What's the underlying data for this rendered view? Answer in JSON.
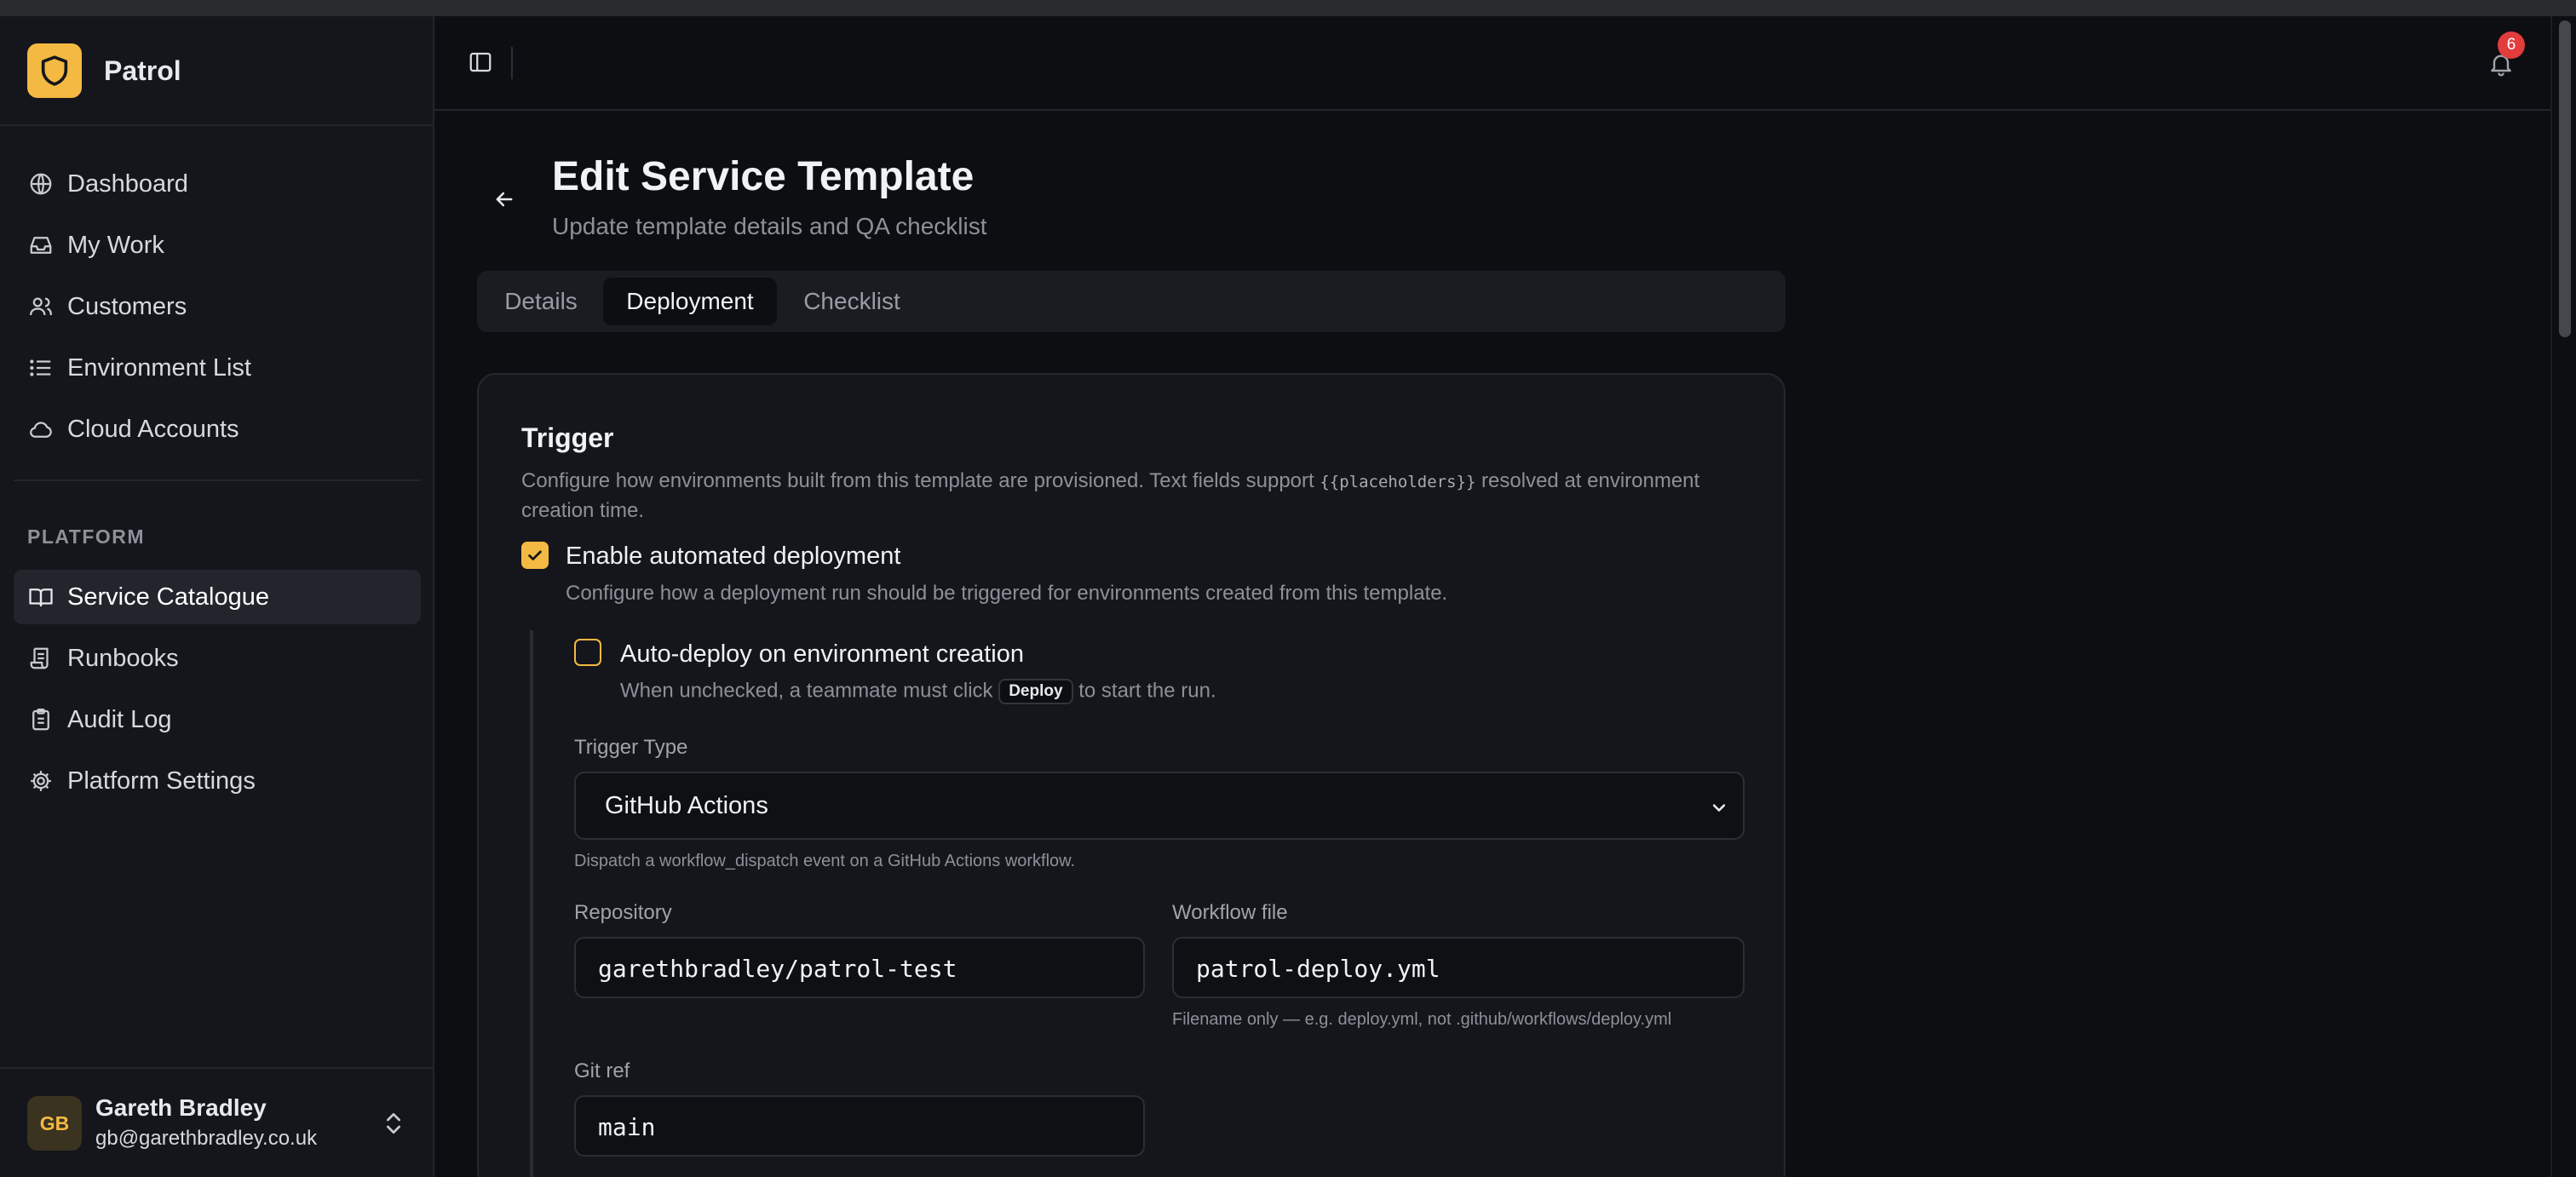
{
  "app": {
    "name": "Patrol"
  },
  "sidebar": {
    "main_items": [
      {
        "label": "Dashboard",
        "icon": "globe-icon"
      },
      {
        "label": "My Work",
        "icon": "inbox-icon"
      },
      {
        "label": "Customers",
        "icon": "users-icon"
      },
      {
        "label": "Environment List",
        "icon": "list-icon"
      },
      {
        "label": "Cloud Accounts",
        "icon": "cloud-icon"
      }
    ],
    "section_label": "PLATFORM",
    "platform_items": [
      {
        "label": "Service Catalogue",
        "icon": "book-icon",
        "active": true
      },
      {
        "label": "Runbooks",
        "icon": "scroll-icon"
      },
      {
        "label": "Audit Log",
        "icon": "clipboard-icon"
      },
      {
        "label": "Platform Settings",
        "icon": "gear-icon"
      }
    ],
    "user": {
      "initials": "GB",
      "name": "Gareth Bradley",
      "email": "gb@garethbradley.co.uk"
    }
  },
  "header": {
    "notification_count": "6"
  },
  "page": {
    "title": "Edit Service Template",
    "subtitle": "Update template details and QA checklist",
    "tabs": [
      {
        "label": "Details"
      },
      {
        "label": "Deployment",
        "active": true
      },
      {
        "label": "Checklist"
      }
    ]
  },
  "trigger": {
    "title": "Trigger",
    "desc_before": "Configure how environments built from this template are provisioned. Text fields support ",
    "desc_code": "{{placeholders}}",
    "desc_after": " resolved at environment creation time.",
    "enable_label": "Enable automated deployment",
    "enable_checked": true,
    "enable_help": "Configure how a deployment run should be triggered for environments created from this template.",
    "auto_label": "Auto-deploy on environment creation",
    "auto_checked": false,
    "auto_help_before": "When unchecked, a teammate must click ",
    "auto_help_kbd": "Deploy",
    "auto_help_after": " to start the run.",
    "trigger_type_label": "Trigger Type",
    "trigger_type_value": "GitHub Actions",
    "trigger_type_help": "Dispatch a workflow_dispatch event on a GitHub Actions workflow.",
    "repository_label": "Repository",
    "repository_value": "garethbradley/patrol-test",
    "workflow_label": "Workflow file",
    "workflow_value": "patrol-deploy.yml",
    "workflow_help": "Filename only — e.g. deploy.yml, not .github/workflows/deploy.yml",
    "gitref_label": "Git ref",
    "gitref_value": "main"
  },
  "colors": {
    "accent": "#f4b942",
    "badge": "#e23c3c",
    "background": "#0d0e12",
    "sidebar": "#15161b"
  }
}
